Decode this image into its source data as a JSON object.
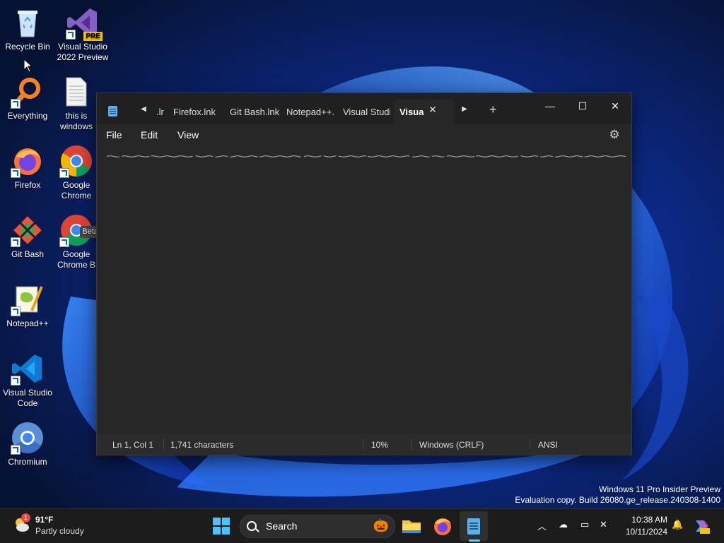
{
  "desktop": {
    "icons": [
      {
        "label": "Recycle Bin",
        "icon": "recycle-bin-icon"
      },
      {
        "label": "Visual Studio 2022 Preview",
        "icon": "visual-studio-preview-icon",
        "badge": "PRE"
      },
      {
        "label": "Everything",
        "icon": "everything-search-icon"
      },
      {
        "label": "this is windows",
        "icon": "text-file-icon"
      },
      {
        "label": "Firefox",
        "icon": "firefox-icon"
      },
      {
        "label": "Google Chrome",
        "icon": "chrome-icon"
      },
      {
        "label": "Git Bash",
        "icon": "git-bash-icon"
      },
      {
        "label": "Google Chrome B",
        "icon": "chrome-beta-icon",
        "badge": "Beta"
      },
      {
        "label": "Notepad++",
        "icon": "notepad-plus-plus-icon"
      },
      {
        "label": "Visual Studio Code",
        "icon": "vscode-icon"
      },
      {
        "label": "Chromium",
        "icon": "chromium-icon"
      }
    ]
  },
  "notepad": {
    "tabs": [
      ".lr",
      "Firefox.lnk",
      "Git Bash.lnk",
      "Notepad++.",
      "Visual Studio",
      "Visua"
    ],
    "active_tab": "Visua",
    "menu": [
      "File",
      "Edit",
      "View"
    ],
    "status": {
      "position": "Ln 1, Col 1",
      "characters": "1,741 characters",
      "zoom": "10%",
      "line_ending": "Windows (CRLF)",
      "encoding": "ANSI"
    }
  },
  "watermark": {
    "line1": "Windows 11 Pro Insider Preview",
    "line2": "Evaluation copy. Build 26080.ge_release.240308-1400"
  },
  "taskbar": {
    "weather": {
      "temp": "91°F",
      "desc": "Partly cloudy",
      "alert_count": "1"
    },
    "search_label": "Search",
    "clock": {
      "time": "10:38 AM",
      "date": "10/11/2024"
    }
  },
  "colors": {
    "accent": "#60cdff",
    "window_bg": "#272727",
    "taskbar_bg": "#1c1c1c"
  }
}
